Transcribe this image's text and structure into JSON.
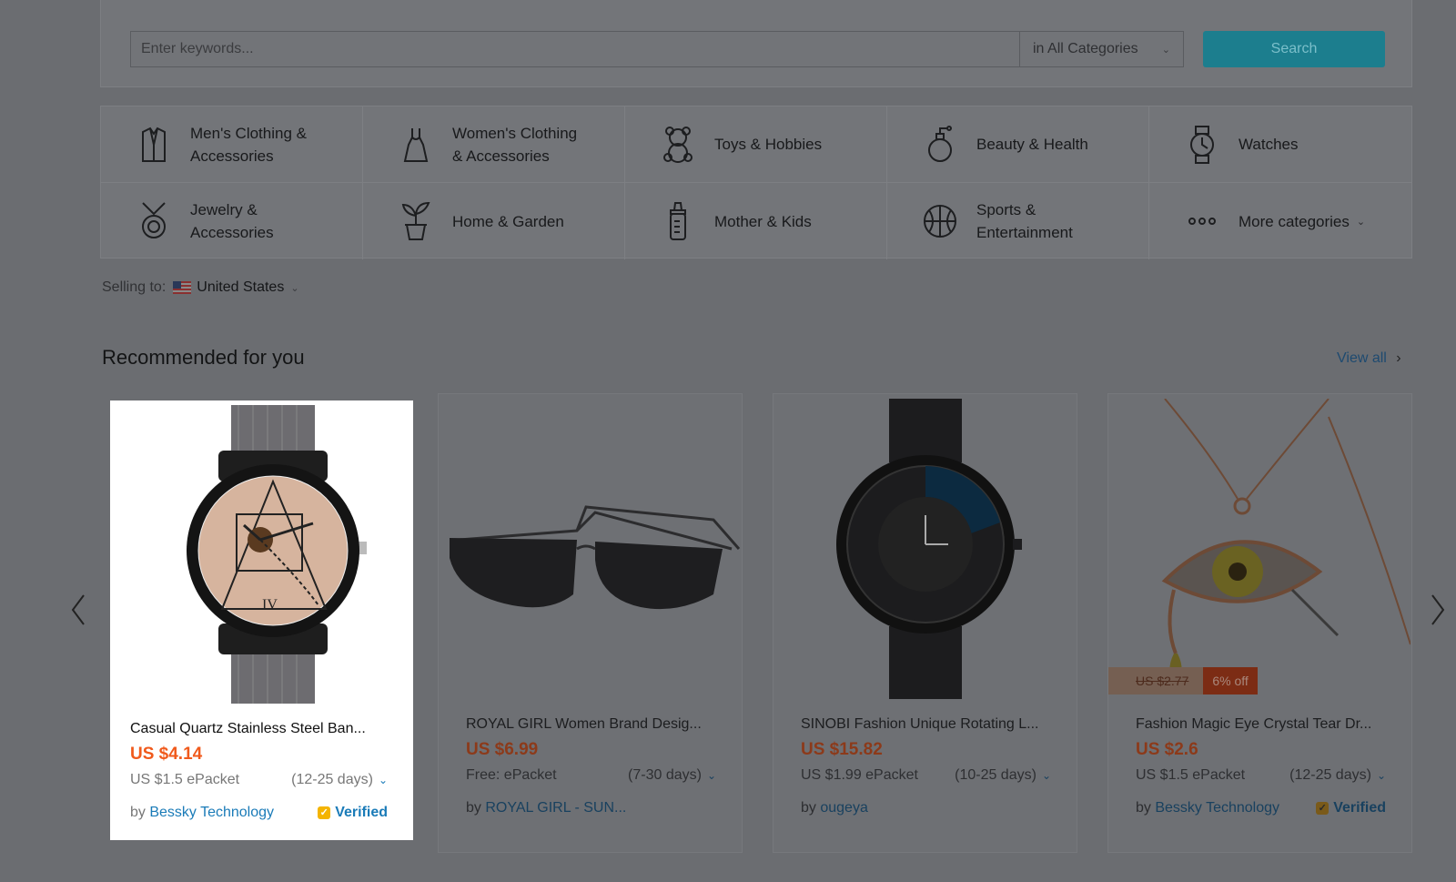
{
  "search": {
    "placeholder": "Enter keywords...",
    "category": "in All Categories",
    "button": "Search"
  },
  "categories": [
    {
      "label": "Men's Clothing &\nAccessories",
      "icon": "shirt-icon"
    },
    {
      "label": "Women's Clothing\n& Accessories",
      "icon": "dress-icon"
    },
    {
      "label": "Toys & Hobbies",
      "icon": "teddy-bear-icon"
    },
    {
      "label": "Beauty & Health",
      "icon": "perfume-icon"
    },
    {
      "label": "Watches",
      "icon": "watch-icon"
    },
    {
      "label": "Jewelry &\nAccessories",
      "icon": "necklace-icon"
    },
    {
      "label": "Home & Garden",
      "icon": "plant-icon"
    },
    {
      "label": "Mother & Kids",
      "icon": "baby-bottle-icon"
    },
    {
      "label": "Sports &\nEntertainment",
      "icon": "basketball-icon"
    },
    {
      "label": "More categories",
      "icon": "more-dots-icon"
    }
  ],
  "selling": {
    "label": "Selling to:",
    "country": "United States"
  },
  "recommended": {
    "title": "Recommended for you",
    "view_all": "View all"
  },
  "products": [
    {
      "title": "Casual Quartz Stainless Steel Ban...",
      "price": "US $4.14",
      "shipping": "US $1.5 ePacket",
      "days": "(12-25 days)",
      "by": "by",
      "seller": "Bessky Technology",
      "verified": "Verified"
    },
    {
      "title": "ROYAL GIRL Women Brand Desig...",
      "price": "US $6.99",
      "shipping": "Free: ePacket",
      "days": "(7-30 days)",
      "by": "by",
      "seller": "ROYAL GIRL - SUN...",
      "verified": ""
    },
    {
      "title": "SINOBI Fashion Unique Rotating L...",
      "price": "US $15.82",
      "shipping": "US $1.99 ePacket",
      "days": "(10-25 days)",
      "by": "by",
      "seller": "ougeya",
      "verified": ""
    },
    {
      "title": "Fashion Magic Eye Crystal Tear Dr...",
      "price": "US $2.6",
      "shipping": "US $1.5 ePacket",
      "days": "(12-25 days)",
      "by": "by",
      "seller": "Bessky Technology",
      "verified": "Verified",
      "old_price": "US $2.77",
      "discount": "6% off"
    }
  ]
}
